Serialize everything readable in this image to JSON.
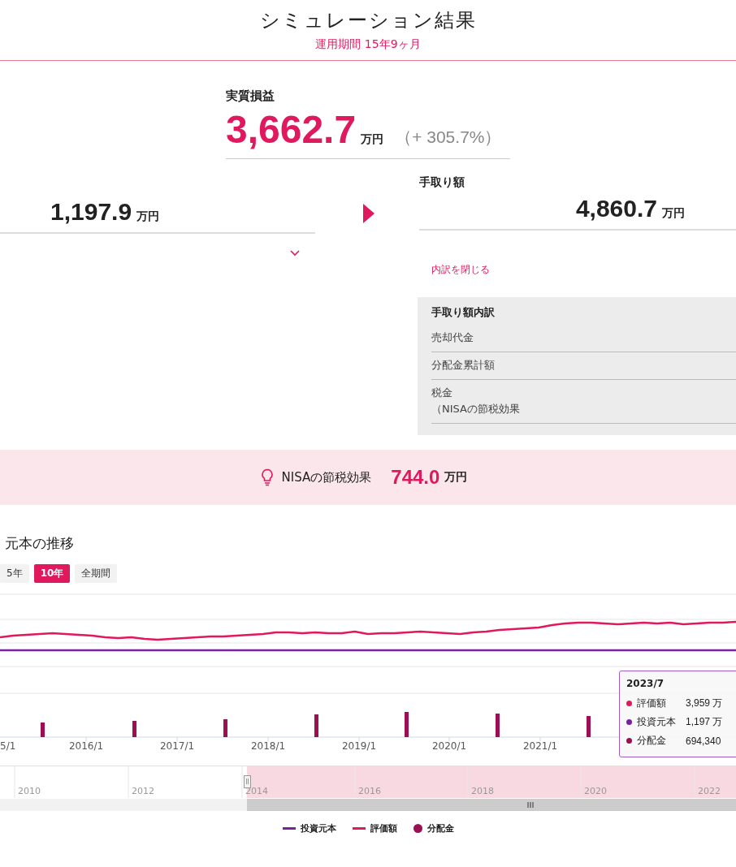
{
  "header": {
    "title": "シミュレーション結果",
    "period": "運用期間 15年9ヶ月"
  },
  "profit": {
    "label": "実質損益",
    "value": "3,662.7",
    "unit": "万円",
    "rate": "（+ 305.7%）"
  },
  "principal": {
    "value": "1,197.9",
    "unit": "万円",
    "expanded": true
  },
  "takehome": {
    "label": "手取り額",
    "value": "4,860.7",
    "unit": "万円"
  },
  "breakdown": {
    "toggle": "内訳を閉じる",
    "title": "手取り額内訳",
    "rows": [
      {
        "label": "売却代金"
      },
      {
        "label": "分配金累計額"
      },
      {
        "label": "税金",
        "note": "（NISAの節税効果"
      }
    ]
  },
  "nisa": {
    "label": "NISAの節税効果",
    "value": "744.0",
    "unit": "万円"
  },
  "chart": {
    "title": "元本の推移",
    "ranges": [
      {
        "label": "5年",
        "selected": false
      },
      {
        "label": "10年",
        "selected": true
      },
      {
        "label": "全期間",
        "selected": false
      }
    ],
    "x_labels": [
      "5/1",
      "2016/1",
      "2017/1",
      "2018/1",
      "2019/1",
      "2020/1",
      "2021/1"
    ],
    "tooltip": {
      "date": "2023/7",
      "rows": [
        {
          "label": "評価額",
          "value": "3,959 万",
          "color": "#e0185e"
        },
        {
          "label": "投資元本",
          "value": "1,197 万",
          "color": "#7b1fa2"
        },
        {
          "label": "分配金",
          "value": "694,340",
          "color": "#9c0f55"
        }
      ]
    },
    "navigator_years": [
      "2010",
      "2012",
      "2014",
      "2016",
      "2018",
      "2020",
      "2022"
    ],
    "legend": [
      {
        "label": "投資元本",
        "kind": "line",
        "color": "#7b1fa2"
      },
      {
        "label": "評価額",
        "kind": "line",
        "color": "#e0185e"
      },
      {
        "label": "分配金",
        "kind": "dot",
        "color": "#9c0f55"
      }
    ]
  }
}
